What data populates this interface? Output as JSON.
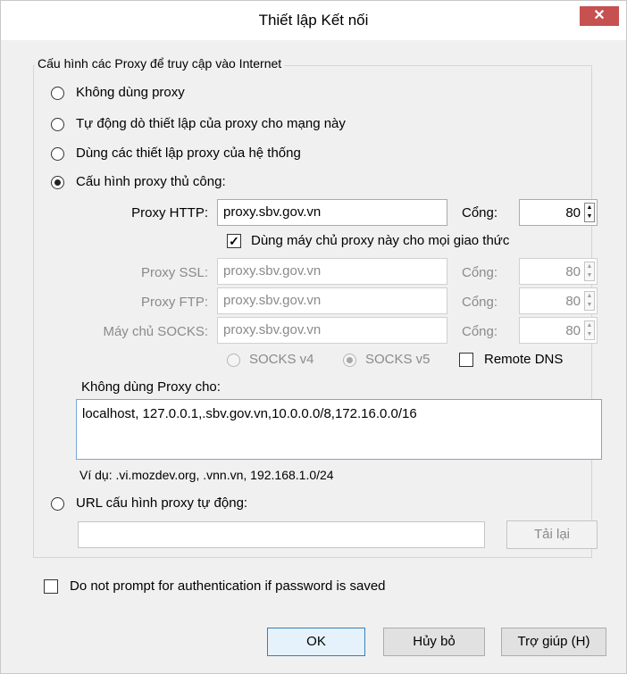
{
  "window": {
    "title": "Thiết lập Kết nối",
    "close_icon": "close-icon"
  },
  "group": {
    "legend": "Cấu hình các Proxy để truy cập vào Internet"
  },
  "options": {
    "no_proxy": "Không dùng proxy",
    "auto_detect": "Tự động dò thiết lập của proxy cho mạng này",
    "system_proxy": "Dùng các thiết lập proxy của hệ thống",
    "manual_proxy": "Cấu hình proxy thủ công:",
    "pac_url": "URL cấu hình proxy tự động:",
    "selected": "manual_proxy"
  },
  "manual": {
    "http_label": "Proxy HTTP:",
    "http_value": "proxy.sbv.gov.vn",
    "http_port_label": "Cổng:",
    "http_port": "80",
    "share_label": "Dùng máy chủ proxy này cho mọi giao thức",
    "share_checked": true,
    "ssl_label": "Proxy SSL:",
    "ssl_value": "proxy.sbv.gov.vn",
    "ssl_port_label": "Cổng:",
    "ssl_port": "80",
    "ftp_label": "Proxy FTP:",
    "ftp_value": "proxy.sbv.gov.vn",
    "ftp_port_label": "Cổng:",
    "ftp_port": "80",
    "socks_label": "Máy chủ SOCKS:",
    "socks_value": "proxy.sbv.gov.vn",
    "socks_port_label": "Cổng:",
    "socks_port": "80",
    "socks_v4": "SOCKS v4",
    "socks_v5": "SOCKS v5",
    "socks_selected": "v5",
    "remote_dns": "Remote DNS",
    "remote_dns_checked": false
  },
  "no_proxy_for": {
    "label": "Không dùng Proxy cho:",
    "value": "localhost, 127.0.0.1,.sbv.gov.vn,10.0.0.0/8,172.16.0.0/16",
    "example": "Ví dụ: .vi.mozdev.org, .vnn.vn, 192.168.1.0/24"
  },
  "pac": {
    "url_value": "",
    "reload_label": "Tải lại"
  },
  "auth": {
    "label": "Do not prompt for authentication if password is saved",
    "checked": false
  },
  "buttons": {
    "ok": "OK",
    "cancel": "Hủy bỏ",
    "help": "Trợ giúp (H)"
  }
}
